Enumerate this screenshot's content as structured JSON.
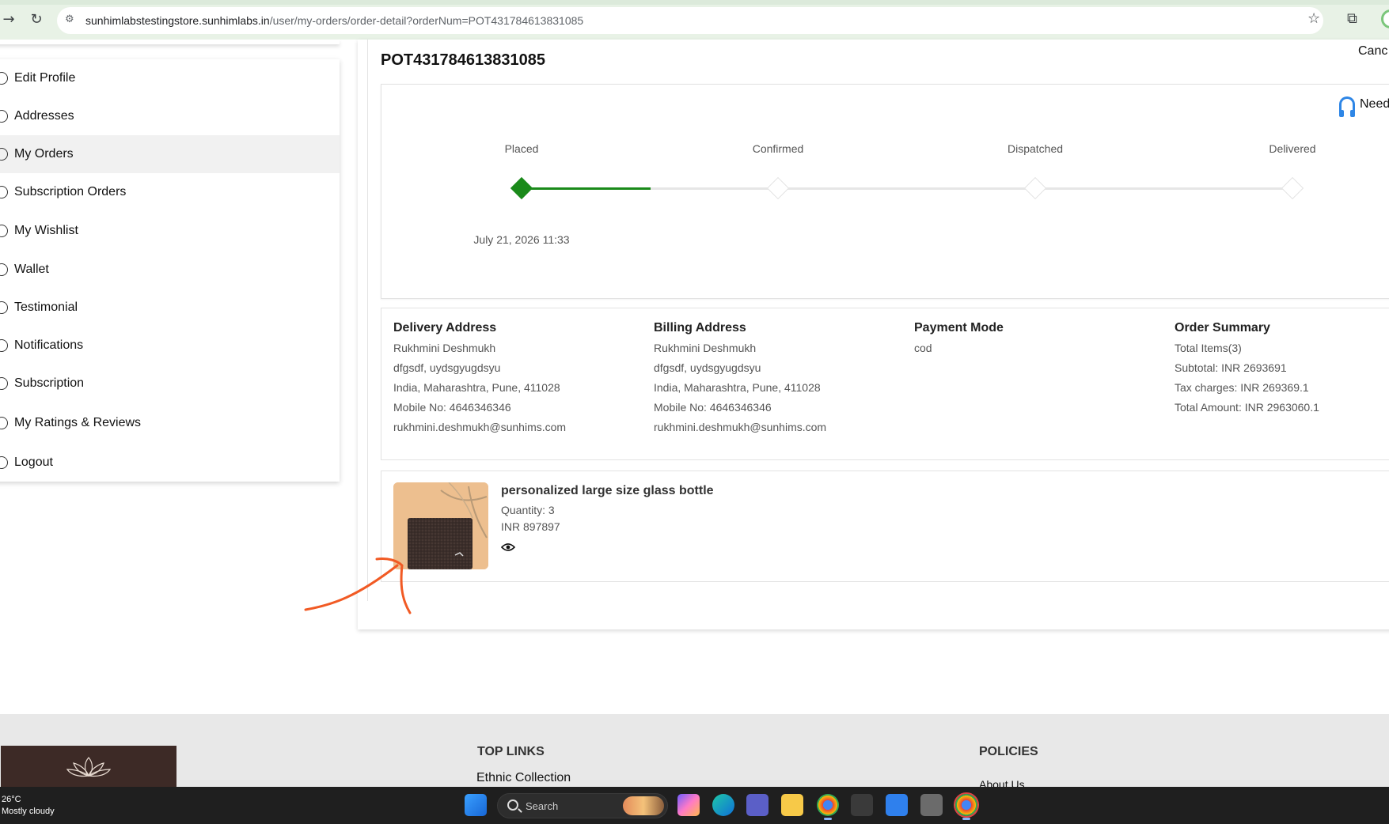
{
  "browser": {
    "url_host": "sunhimlabstestingstore.sunhimlabs.in",
    "url_path": "/user/my-orders/order-detail?orderNum=POT431784613831085"
  },
  "sidebar": {
    "items": [
      {
        "label": "Edit Profile"
      },
      {
        "label": "Addresses"
      },
      {
        "label": "My Orders"
      },
      {
        "label": "Subscription Orders"
      },
      {
        "label": "My Wishlist"
      },
      {
        "label": "Wallet"
      },
      {
        "label": "Testimonial"
      },
      {
        "label": "Notifications"
      },
      {
        "label": "Subscription"
      },
      {
        "label": "My Ratings & Reviews"
      },
      {
        "label": "Logout"
      }
    ],
    "active_index": 2
  },
  "order": {
    "number": "POT431784613831085",
    "cancel_label": "Canc",
    "need_help_label": "Need"
  },
  "tracking": {
    "steps": [
      {
        "label": "Placed",
        "done": true
      },
      {
        "label": "Confirmed",
        "done": false
      },
      {
        "label": "Dispatched",
        "done": false
      },
      {
        "label": "Delivered",
        "done": false
      }
    ],
    "placed_date": "July 21, 2026 11:33",
    "progress_color": "#1a8a1a"
  },
  "delivery_address": {
    "title": "Delivery Address",
    "name": "Rukhmini Deshmukh",
    "line1": "dfgsdf, uydsgyugdsyu",
    "line2": "India, Maharashtra, Pune, 411028",
    "mobile": "Mobile No: 4646346346",
    "email": "rukhmini.deshmukh@sunhims.com"
  },
  "billing_address": {
    "title": "Billing Address",
    "name": "Rukhmini Deshmukh",
    "line1": "dfgsdf, uydsgyugdsyu",
    "line2": "India, Maharashtra, Pune, 411028",
    "mobile": "Mobile No: 4646346346",
    "email": "rukhmini.deshmukh@sunhims.com"
  },
  "payment": {
    "title": "Payment Mode",
    "mode": "cod"
  },
  "summary": {
    "title": "Order Summary",
    "total_items": "Total Items(3)",
    "subtotal": "Subtotal: INR 2693691",
    "tax": "Tax charges: INR 269369.1",
    "total": "Total Amount: INR 2963060.1"
  },
  "product": {
    "name": "personalized large size glass bottle",
    "quantity": "Quantity: 3",
    "price": "INR 897897"
  },
  "footer": {
    "top_links_title": "TOP LINKS",
    "top_link_1": "Ethnic Collection",
    "policies_title": "POLICIES",
    "policy_link_1": "About Us"
  },
  "taskbar": {
    "temperature": "26°C",
    "weather": "Mostly cloudy",
    "search_placeholder": "Search"
  }
}
